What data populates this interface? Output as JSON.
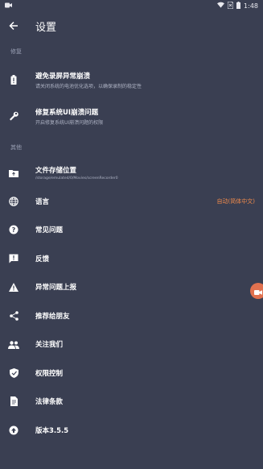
{
  "status_bar": {
    "time": "1:48"
  },
  "appbar": {
    "title": "设置"
  },
  "sections": {
    "repair": "修复",
    "other": "其他"
  },
  "items": {
    "avoid_crash": {
      "label": "避免录屏异常崩溃",
      "sub": "请关闭系统的电池优化选项，以确保录制的稳定性"
    },
    "fix_ui": {
      "label": "修复系统UI崩溃问题",
      "sub": "开启修复系统UI崩溃问题的权限"
    },
    "storage": {
      "label": "文件存储位置",
      "sub": "/storage/emulated/0/Movies/screenRecorder0"
    },
    "language": {
      "label": "语言",
      "value": "自动(简体中文)"
    },
    "faq": {
      "label": "常见问题"
    },
    "feedback": {
      "label": "反馈"
    },
    "report": {
      "label": "异常问题上报"
    },
    "share": {
      "label": "推荐给朋友"
    },
    "follow": {
      "label": "关注我们"
    },
    "permissions": {
      "label": "权限控制"
    },
    "legal": {
      "label": "法律条款"
    },
    "version": {
      "label": "版本3.5.5"
    }
  },
  "colors": {
    "background": "#3a3f52",
    "accent": "#f08a4b",
    "fab": "#e0714f"
  },
  "icons": {
    "back": "arrow-back-icon",
    "battery": "battery-alert-icon",
    "wrench": "wrench-icon",
    "folder": "folder-icon",
    "globe": "globe-icon",
    "help": "help-circle-icon",
    "feedback": "feedback-icon",
    "warning": "warning-icon",
    "share": "share-icon",
    "people": "people-icon",
    "shield": "shield-check-icon",
    "document": "document-icon",
    "upgrade": "upgrade-circle-icon"
  }
}
